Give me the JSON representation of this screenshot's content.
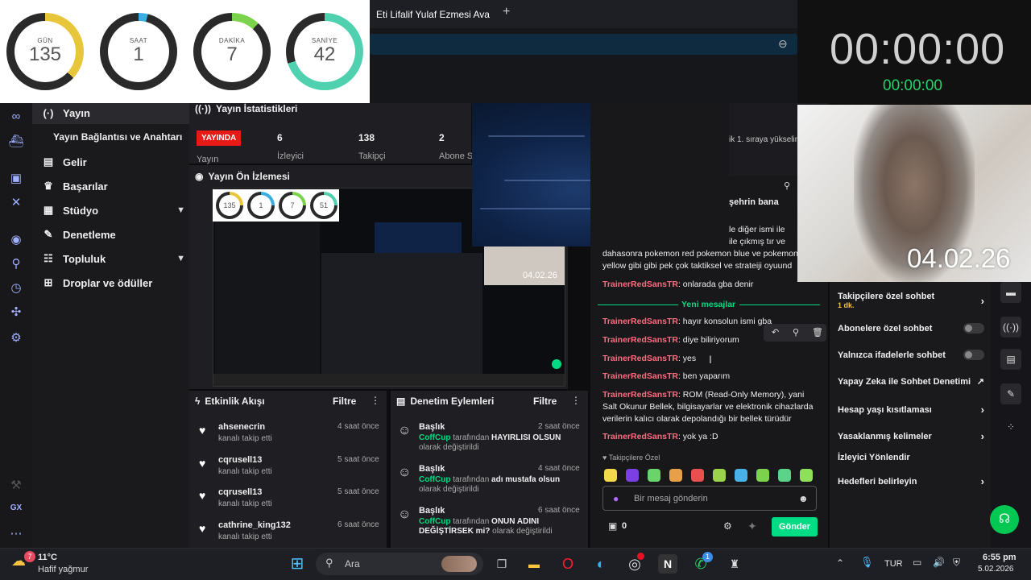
{
  "countdown": {
    "items": [
      {
        "label": "GÜN",
        "value": "135",
        "color": "#e8c63a",
        "fraction": 0.37
      },
      {
        "label": "SAAT",
        "value": "1",
        "color": "#3aaee0",
        "fraction": 0.04
      },
      {
        "label": "DAKİKA",
        "value": "7",
        "color": "#7ad34a",
        "fraction": 0.12
      },
      {
        "label": "SANİYE",
        "value": "42",
        "color": "#4fd1b0",
        "fraction": 0.7
      }
    ]
  },
  "browser": {
    "active_tab": "Eti Lifalif Yulaf Ezmesi Ava",
    "new_tab_icon": "plus-icon",
    "zoom_icon": "zoom-out-icon"
  },
  "timer": {
    "main": "00:00:00",
    "sub": "00:00:00"
  },
  "webcam": {
    "date": "04.02.26"
  },
  "nav": {
    "items": [
      {
        "icon": "broadcast-icon",
        "label": "Yayın"
      },
      {
        "icon": "",
        "label": "Yayın Bağlantısı ve Anahtarı"
      },
      {
        "icon": "money-icon",
        "label": "Gelir"
      },
      {
        "icon": "trophy-icon",
        "label": "Başarılar"
      },
      {
        "icon": "studio-icon",
        "label": "Stüdyo"
      },
      {
        "icon": "wrench-icon",
        "label": "Denetleme"
      },
      {
        "icon": "community-icon",
        "label": "Topluluk"
      },
      {
        "icon": "gift-icon",
        "label": "Droplar ve ödüller"
      }
    ]
  },
  "stats": {
    "title": "Yayın İstatistikleri",
    "live_badge": "YAYINDA",
    "items": [
      {
        "value": "",
        "label": "Yayın"
      },
      {
        "value": "6",
        "label": "İzleyici"
      },
      {
        "value": "138",
        "label": "Takipçi"
      },
      {
        "value": "2",
        "label": "Abone S"
      }
    ]
  },
  "preview": {
    "title": "Yayın Ön İzlemesi",
    "mini": [
      {
        "value": "135",
        "color": "#e8c63a"
      },
      {
        "value": "1",
        "color": "#3aaee0"
      },
      {
        "value": "7",
        "color": "#7ad34a"
      },
      {
        "value": "51",
        "color": "#4fd1b0"
      }
    ],
    "date": "04.02.26"
  },
  "activity": {
    "title": "Etkinlik Akışı",
    "filter": "Filtre",
    "items": [
      {
        "name": "ahsenecrin",
        "sub": "kanalı takip etti",
        "time": "4 saat önce"
      },
      {
        "name": "cqrusell13",
        "sub": "kanalı takip etti",
        "time": "5 saat önce"
      },
      {
        "name": "cqrusell13",
        "sub": "kanalı takip etti",
        "time": "5 saat önce"
      },
      {
        "name": "cathrine_king132",
        "sub": "kanalı takip etti",
        "time": "6 saat önce"
      }
    ]
  },
  "modlog": {
    "title": "Denetim Eylemleri",
    "filter": "Filtre",
    "items": [
      {
        "title": "Başlık",
        "user": "CoffCup",
        "pre": "tarafından",
        "value": "HAYIRLISI OLSUN",
        "post": "olarak değiştirildi",
        "time": "2 saat önce"
      },
      {
        "title": "Başlık",
        "user": "CoffCup",
        "pre": "tarafından",
        "value": "adı mustafa olsun",
        "post": "olarak değiştirildi",
        "time": "4 saat önce"
      },
      {
        "title": "Başlık",
        "user": "CoffCup",
        "pre": "tarafından",
        "value": "ONUN ADINI DEĞİŞTİRSEK mi?",
        "post": "olarak değiştirildi",
        "time": "6 saat önce"
      }
    ]
  },
  "chat": {
    "top_snippet": "ik 1. sıraya yükselin",
    "pinned_snippet": "şehrin bana",
    "prev_lines": [
      "le diğer ismi ile",
      "dahasonra pokemon red pokemon blue ve pokemon",
      "yellow gibi gibi pek çok taktiksel ve strateiji oyuund"
    ],
    "prev_line2_tail": "ile çıkmış tır ve",
    "messages_before": [
      {
        "user": "TrainerRedSansTR",
        "text": ": onlarada gba denir"
      }
    ],
    "new_messages_label": "Yeni mesajlar",
    "messages": [
      {
        "user": "TrainerRedSansTR",
        "text": ": hayır konsolun ismi gba"
      },
      {
        "user": "TrainerRedSansTR",
        "text": ": diye biliriyorum"
      },
      {
        "user": "TrainerRedSansTR",
        "text": ": yes"
      },
      {
        "user": "TrainerRedSansTR",
        "text": ": ben yaparım"
      },
      {
        "user": "TrainerRedSansTR",
        "text": ": ROM (Read-Only Memory), yani Salt Okunur Bellek, bilgisayarlar ve elektronik cihazlarda verilerin kalıcı olarak depolandığı bir bellek türüdür"
      },
      {
        "user": "TrainerRedSansTR",
        "text": ": yok ya :D"
      }
    ],
    "emote_label": "Takipçilere Özel",
    "input_placeholder": "Bir mesaj gönderin",
    "points": "0",
    "send_label": "Gönder"
  },
  "settings": {
    "items": [
      {
        "label": "Takipçilere özel sohbet",
        "sub": "1 dk.",
        "control": "arrow"
      },
      {
        "label": "Abonelere özel sohbet",
        "sub": "",
        "control": "toggle"
      },
      {
        "label": "Yalnızca ifadelerle sohbet",
        "sub": "",
        "control": "toggle"
      },
      {
        "label": "Yapay Zeka ile Sohbet Denetimi",
        "sub": "",
        "control": "external"
      },
      {
        "label": "Hesap yaşı kısıtlaması",
        "sub": "",
        "control": "arrow"
      },
      {
        "label": "Yasaklanmış kelimeler",
        "sub": "",
        "control": "arrow"
      },
      {
        "label": "İzleyici Yönlendir",
        "sub": "",
        "control": "none"
      },
      {
        "label": "Hedefleri belirleyin",
        "sub": "",
        "control": "arrow"
      }
    ]
  },
  "taskbar": {
    "weather_temp": "11°C",
    "weather_desc": "Hafif yağmur",
    "weather_badge": "7",
    "search_label": "Ara",
    "lang": "TUR",
    "time": "6:55 pm",
    "date": "5.02.2026",
    "whatsapp_badge": "1"
  },
  "colors": {
    "accent_green": "#00db84",
    "live_red": "#e91916",
    "chat_name": "#ff6a7f"
  }
}
